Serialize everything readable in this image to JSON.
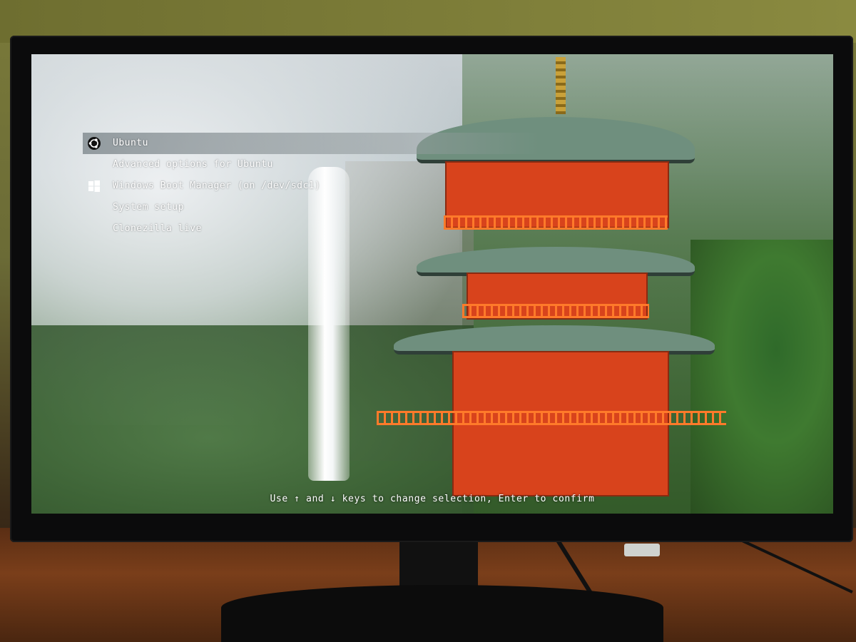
{
  "boot_menu": {
    "items": [
      {
        "label": "Ubuntu",
        "icon": "ubuntu-logo-icon",
        "selected": true
      },
      {
        "label": "Advanced options for Ubuntu",
        "icon": null,
        "selected": false
      },
      {
        "label": "Windows Boot Manager (on /dev/sdc1)",
        "icon": "windows-logo-icon",
        "selected": false
      },
      {
        "label": "System setup",
        "icon": null,
        "selected": false
      },
      {
        "label": "Clonezilla live",
        "icon": null,
        "selected": false
      }
    ],
    "footer": "Use ↑ and ↓ keys to change selection, Enter to confirm"
  },
  "colors": {
    "menu_text": "#ffffff",
    "selection_bar": "#7f8a8e",
    "pagoda_red": "#d8431c",
    "roof_green": "#6f8f7e"
  }
}
